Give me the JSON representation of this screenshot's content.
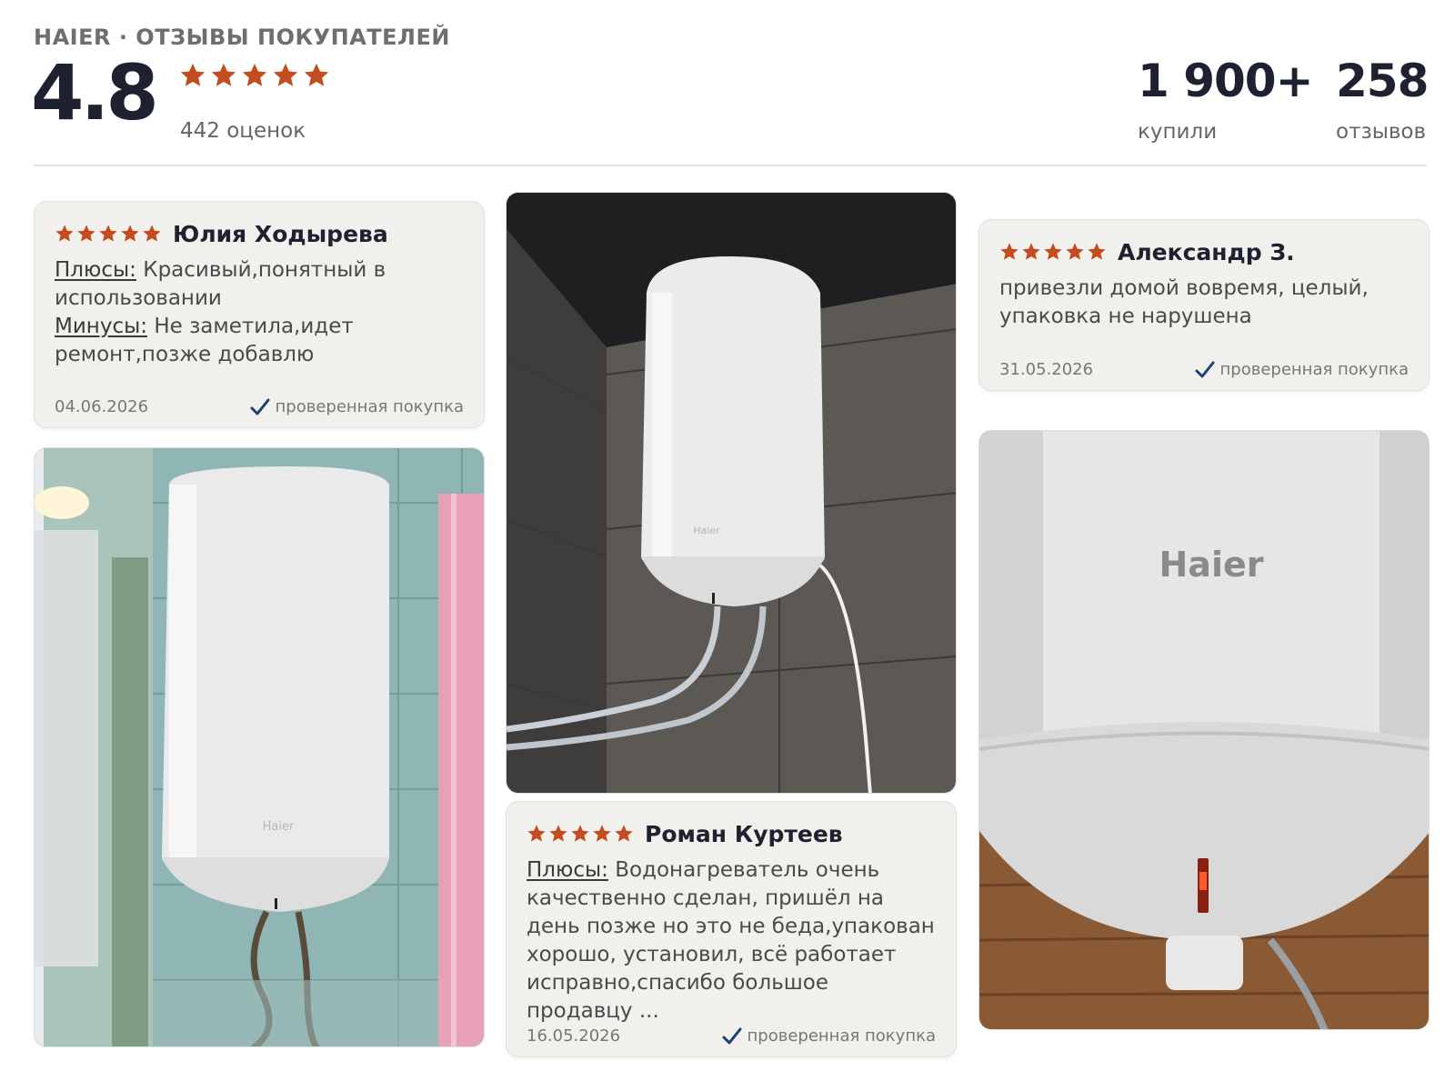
{
  "header": {
    "brand_line": "HAIER · ОТЗЫВЫ ПОКУПАТЕЛЕЙ",
    "rating": "4.8",
    "rating_count": "442 оценок",
    "stats": [
      {
        "value": "1 900+",
        "label": "купили"
      },
      {
        "value": "258",
        "label": "отзывов"
      }
    ],
    "star_color": "#c24c1f"
  },
  "reviews": [
    {
      "author": "Юлия Ходырева",
      "stars": 5,
      "pros_label": "Плюсы:",
      "pros": "Красивый,понятный в использовании",
      "cons_label": "Минусы:",
      "cons": "Не заметила,идет ремонт,позже добавлю",
      "date": "04.06.2026",
      "verified": "проверенная покупка"
    },
    {
      "author": "Александр З.",
      "stars": 5,
      "text": "привезли домой вовремя, целый, упаковка не нарушена",
      "date": "31.05.2026",
      "verified": "проверенная покупка"
    },
    {
      "author": "Роман Куртеев",
      "stars": 5,
      "pros_label": "Плюсы:",
      "pros": "Водонагреватель очень качественно сделан, пришёл на день позже но это не беда,упакован хорошо, установил, всё работает исправно,спасибо большое продавцу ...",
      "date": "16.05.2026",
      "verified": "проверенная покупка"
    }
  ],
  "photos": [
    {
      "brand_mark": "Haier",
      "icon": "water-heater-bathroom-photo"
    },
    {
      "brand_mark": "Haier",
      "icon": "water-heater-tiles-photo"
    },
    {
      "brand_mark": "Haier",
      "icon": "water-heater-closeup-photo"
    }
  ]
}
